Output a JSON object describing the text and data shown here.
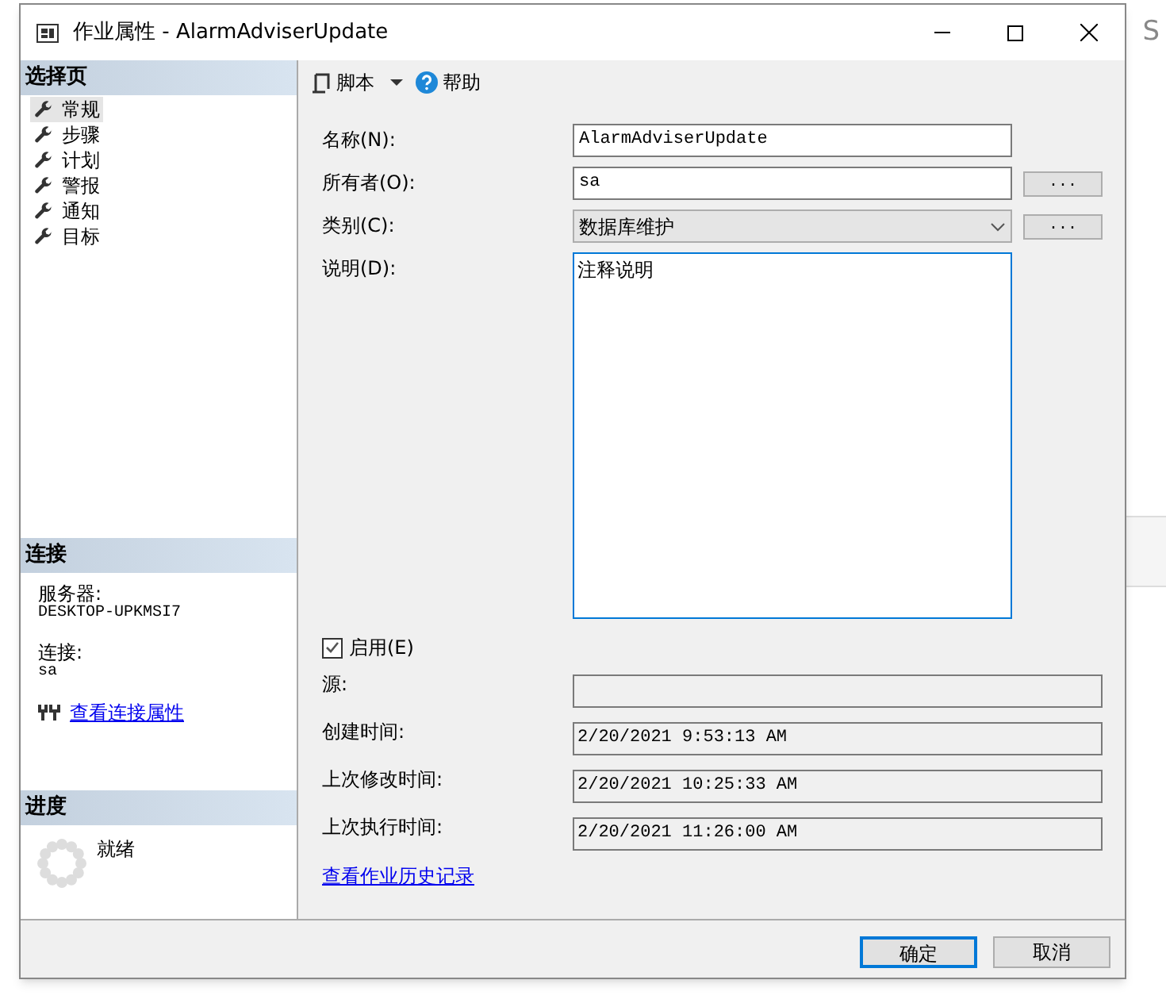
{
  "background": {
    "texts": [
      "S"
    ]
  },
  "window": {
    "title": "作业属性 - AlarmAdviserUpdate"
  },
  "sidebar": {
    "header": "选择页",
    "items": [
      {
        "label": "常规",
        "selected": true
      },
      {
        "label": "步骤",
        "selected": false
      },
      {
        "label": "计划",
        "selected": false
      },
      {
        "label": "警报",
        "selected": false
      },
      {
        "label": "通知",
        "selected": false
      },
      {
        "label": "目标",
        "selected": false
      }
    ]
  },
  "connection": {
    "header": "连接",
    "server_label": "服务器:",
    "server": "DESKTOP-UPKMSI7",
    "conn_label": "连接:",
    "conn": "sa",
    "link": "查看连接属性"
  },
  "progress": {
    "header": "进度",
    "status": "就绪"
  },
  "toolbar": {
    "script": "脚本",
    "help": "帮助"
  },
  "form": {
    "rows": [
      {
        "kind": "text",
        "label": "名称(N):",
        "value": "AlarmAdviserUpdate",
        "browse": false
      },
      {
        "kind": "text",
        "label": "所有者(O):",
        "value": "sa",
        "browse": true
      },
      {
        "kind": "select",
        "label": "类别(C):",
        "value": "数据库维护",
        "browse": true
      },
      {
        "kind": "area",
        "label": "说明(D):",
        "value": "注释说明",
        "browse": false
      }
    ],
    "browse_label": "...",
    "enabled": {
      "label": "启用(E)",
      "checked": true
    },
    "info": [
      {
        "label": "源:"
      },
      {
        "label": "创建时间:",
        "value": "2/20/2021 9:53:13 AM"
      },
      {
        "label": "上次修改时间:",
        "value": "2/20/2021 10:25:33 AM"
      },
      {
        "label": "上次执行时间:",
        "value": "2/20/2021 11:26:00 AM"
      }
    ],
    "history_link": "查看作业历史记录"
  },
  "buttons": [
    {
      "label": "确定",
      "default": true
    },
    {
      "label": "取消",
      "default": false
    }
  ]
}
